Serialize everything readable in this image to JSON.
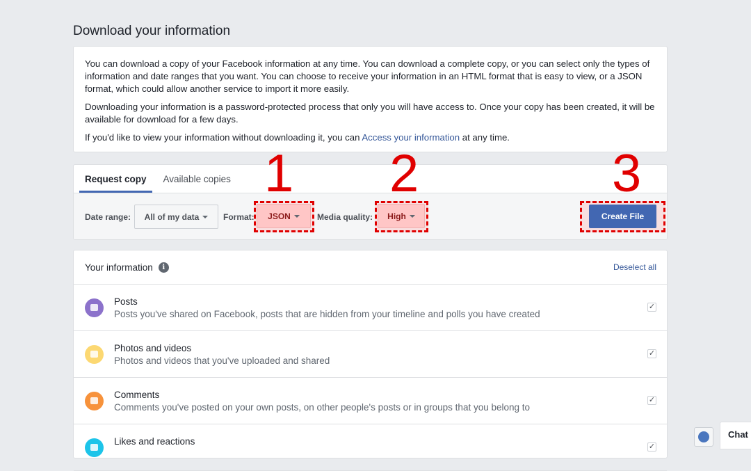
{
  "title": "Download your information",
  "intro": {
    "p1": "You can download a copy of your Facebook information at any time. You can download a complete copy, or you can select only the types of information and date ranges that you want. You can choose to receive your information in an HTML format that is easy to view, or a JSON format, which could allow another service to import it more easily.",
    "p2": "Downloading your information is a password-protected process that only you will have access to. Once your copy has been created, it will be available for download for a few days.",
    "p3_pre": "If you'd like to view your information without downloading it, you can ",
    "p3_link": "Access your information",
    "p3_post": " at any time."
  },
  "tabs": [
    "Request copy",
    "Available copies"
  ],
  "filters": {
    "date_label": "Date range:",
    "date_value": "All of my data",
    "format_label": "Format:",
    "format_value": "JSON",
    "quality_label": "Media quality:",
    "quality_value": "High",
    "create": "Create File"
  },
  "annotations": [
    "1",
    "2",
    "3"
  ],
  "info": {
    "header": "Your information",
    "info_icon": "i",
    "deselect": "Deselect all",
    "items": [
      {
        "title": "Posts",
        "desc": "Posts you've shared on Facebook, posts that are hidden from your timeline and polls you have created",
        "color": "#8c72cb"
      },
      {
        "title": "Photos and videos",
        "desc": "Photos and videos that you've uploaded and shared",
        "color": "#fcd872"
      },
      {
        "title": "Comments",
        "desc": "Comments you've posted on your own posts, on other people's posts or in groups that you belong to",
        "color": "#f7923b"
      },
      {
        "title": "Likes and reactions",
        "desc": "",
        "color": "#1dc4e9"
      }
    ]
  },
  "chat": "Chat"
}
